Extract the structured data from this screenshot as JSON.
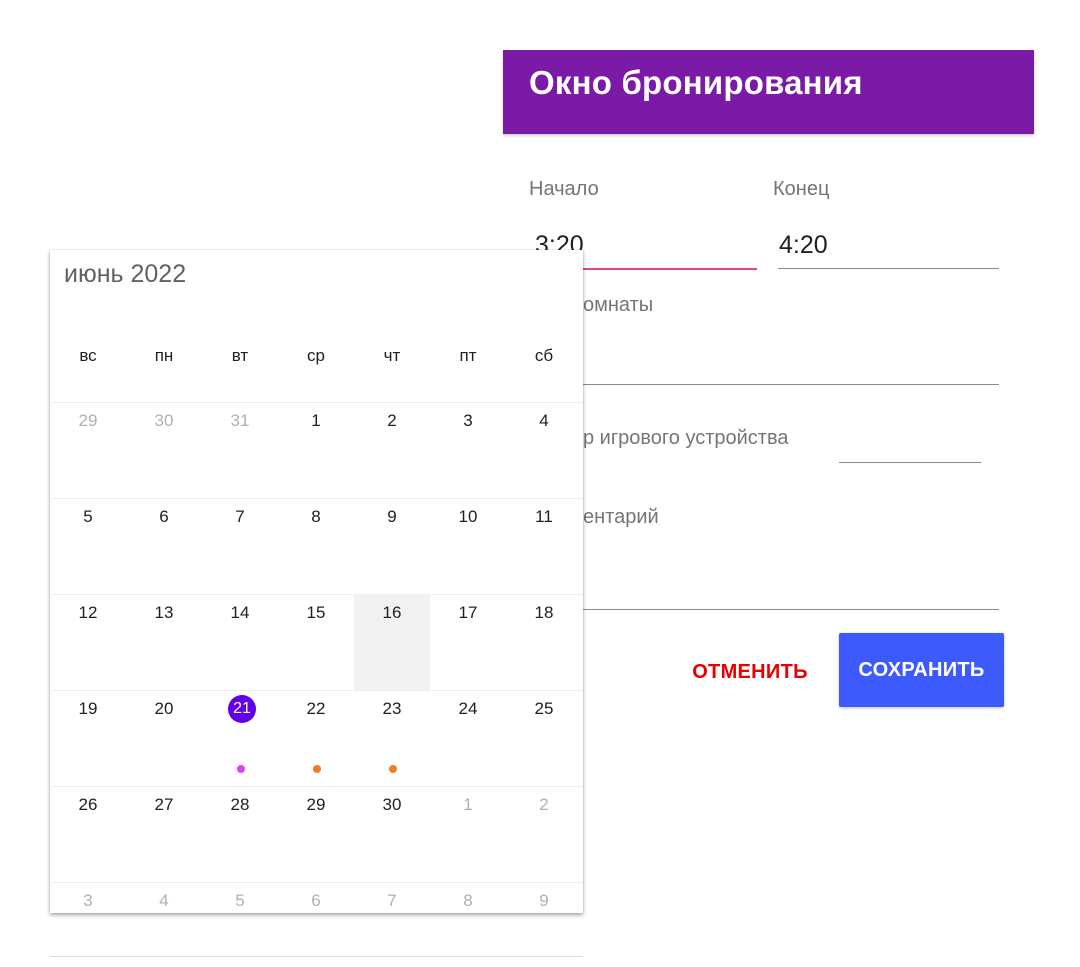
{
  "booking": {
    "title": "Окно бронирования",
    "start_label": "Начало",
    "start_value": "3:20",
    "end_label": "Конец",
    "end_value": "4:20",
    "room_label_partial": "омнаты",
    "device_label_partial": "р игрового устройства",
    "comment_label_partial": "ентарий",
    "cancel_label": "ОТМЕНИТЬ",
    "save_label": "СОХРАНИТЬ",
    "colors": {
      "header": "#7b1aa6",
      "save": "#3d5afe",
      "cancel": "#e60000",
      "focus_underline": "#e8457a"
    }
  },
  "calendar": {
    "month_title": "июнь 2022",
    "weekdays": [
      "вс",
      "пн",
      "вт",
      "ср",
      "чт",
      "пт",
      "сб"
    ],
    "weeks": [
      [
        {
          "d": "29",
          "m": true
        },
        {
          "d": "30",
          "m": true
        },
        {
          "d": "31",
          "m": true
        },
        {
          "d": "1"
        },
        {
          "d": "2"
        },
        {
          "d": "3"
        },
        {
          "d": "4"
        }
      ],
      [
        {
          "d": "5"
        },
        {
          "d": "6"
        },
        {
          "d": "7"
        },
        {
          "d": "8"
        },
        {
          "d": "9"
        },
        {
          "d": "10"
        },
        {
          "d": "11"
        }
      ],
      [
        {
          "d": "12"
        },
        {
          "d": "13"
        },
        {
          "d": "14"
        },
        {
          "d": "15"
        },
        {
          "d": "16",
          "hover": true
        },
        {
          "d": "17"
        },
        {
          "d": "18"
        }
      ],
      [
        {
          "d": "19"
        },
        {
          "d": "20"
        },
        {
          "d": "21",
          "selected": true,
          "dot": "#e040fb"
        },
        {
          "d": "22",
          "dot": "#f07b2a"
        },
        {
          "d": "23",
          "dot": "#f07b2a"
        },
        {
          "d": "24"
        },
        {
          "d": "25"
        }
      ],
      [
        {
          "d": "26"
        },
        {
          "d": "27"
        },
        {
          "d": "28"
        },
        {
          "d": "29"
        },
        {
          "d": "30"
        },
        {
          "d": "1",
          "m": true
        },
        {
          "d": "2",
          "m": true
        }
      ],
      [
        {
          "d": "3",
          "m": true
        },
        {
          "d": "4",
          "m": true
        },
        {
          "d": "5",
          "m": true
        },
        {
          "d": "6",
          "m": true
        },
        {
          "d": "7",
          "m": true
        },
        {
          "d": "8",
          "m": true
        },
        {
          "d": "9",
          "m": true
        }
      ]
    ],
    "colors": {
      "selected": "#6200ea",
      "hover": "#f1f1f1"
    }
  }
}
